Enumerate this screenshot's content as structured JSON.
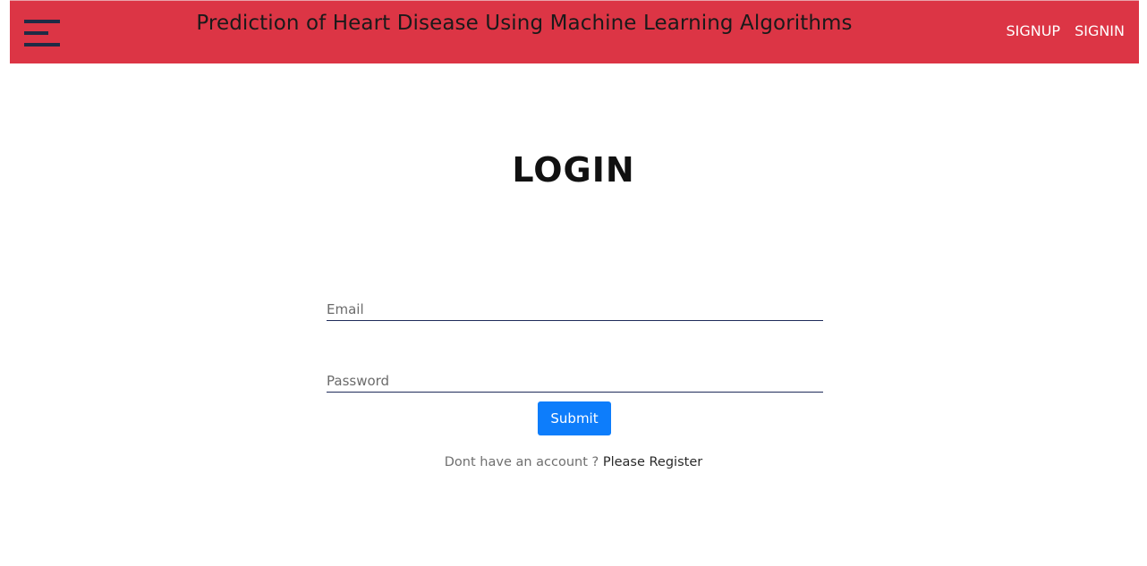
{
  "navbar": {
    "menu_icon": "hamburger-menu-icon",
    "title": "Prediction of Heart Disease Using Machine Learning Algorithms",
    "links": [
      {
        "label": "SIGNUP"
      },
      {
        "label": "SIGNIN"
      }
    ],
    "background_color": "#dc3545"
  },
  "login": {
    "heading": "LOGIN",
    "email": {
      "placeholder": "Email",
      "value": ""
    },
    "password": {
      "placeholder": "Password",
      "value": ""
    },
    "submit_label": "Submit",
    "submit_color": "#0d7dfb",
    "register_prompt": "Dont have an account ?",
    "register_link": "Please Register"
  }
}
